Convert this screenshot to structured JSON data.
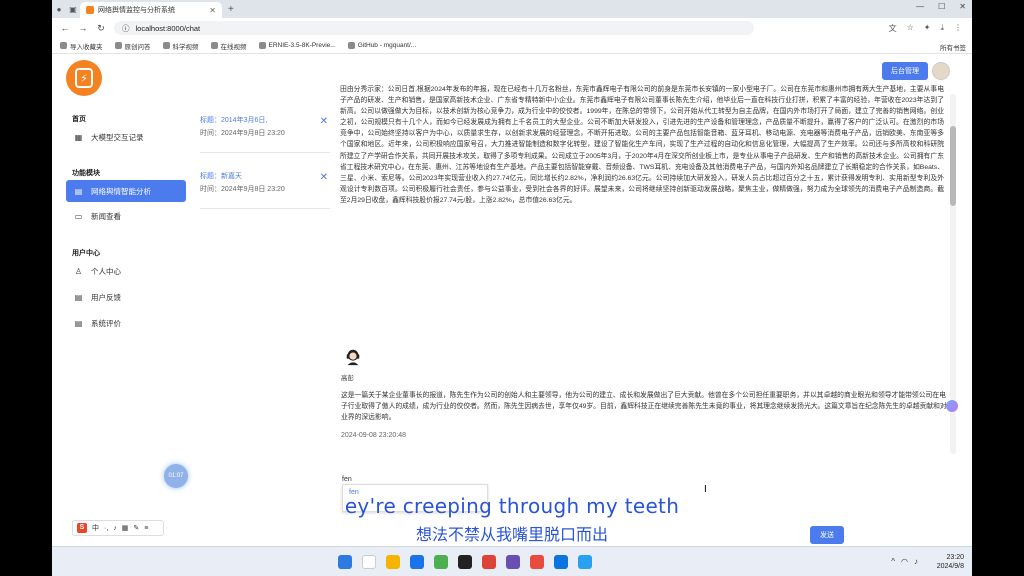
{
  "browser": {
    "tab_title": "网络舆情监控与分析系统",
    "url": "localhost:8000/chat",
    "bookmarks": [
      "导入收藏夹",
      "原创问答",
      "科学视频",
      "在线视频",
      "ERNIE-3.5-8K-Previe...",
      "GitHub - mgquant/..."
    ],
    "all_bookmarks": "所有书签"
  },
  "sidebar": {
    "home_title": "首页",
    "home_items": [
      {
        "label": "大模型交互记录",
        "icon": "grid-icon"
      }
    ],
    "func_title": "功能模块",
    "func_items": [
      {
        "label": "网络舆情智能分析",
        "icon": "doc-icon",
        "active": true
      },
      {
        "label": "新闻查看",
        "icon": "news-icon",
        "active": false
      }
    ],
    "user_title": "用户中心",
    "user_items": [
      {
        "label": "个人中心",
        "icon": "user-icon"
      },
      {
        "label": "用户反馈",
        "icon": "feedback-icon"
      },
      {
        "label": "系统评价",
        "icon": "rating-icon"
      }
    ],
    "assistant_ball": "01:07"
  },
  "history": [
    {
      "title": "标题：2014年3月6日,",
      "date": "时间：2024年9月8日 23:20"
    },
    {
      "title": "标题：新嘉天",
      "date": "时间：2024年9月8日 23:20"
    }
  ],
  "header": {
    "admin_button": "后台管理"
  },
  "main": {
    "paragraph": "田由分秀示家：公司日首,根据2024年发布的年报，现在已经有十几万名粉丝，东莞市鑫辉电子有限公司的前身是东莞市长安镇的一家小型电子厂。公司在东莞市和惠州市拥有两大生产基地，主要从事电子产品的研发、生产和销售，是国家高新技术企业、广东省专精特新中小企业。东莞市鑫辉电子有限公司董事长陈先生介绍，他毕业后一直在科技行业打拼，积累了丰富的经验，年营收在2023年达到了新高。公司以做强做大为目标，以技术创新为核心竞争力，成为行业中的佼佼者。1999年，在陈总的带领下，公司开始从代工转型为自主品牌，在国内外市场打开了局面，建立了完善的销售网络。创业之初，公司规模只有十几个人，而如今已经发展成为拥有上千名员工的大型企业。公司不断加大研发投入，引进先进的生产设备和管理理念，产品质量不断提升，赢得了客户的广泛认可。在激烈的市场竞争中，公司始终坚持以客户为中心，以质量求生存，以创新求发展的经营理念，不断开拓进取。公司的主要产品包括智能音箱、蓝牙耳机、移动电源、充电器等消费电子产品，远销欧美、东南亚等多个国家和地区。近年来，公司积极响应国家号召，大力推进智能制造和数字化转型，建设了智能化生产车间，实现了生产过程的自动化和信息化管理，大幅提高了生产效率。公司还与多所高校和科研院所建立了产学研合作关系，共同开展技术攻关，取得了多项专利成果。公司成立于2005年3月，于2020年4月在深交所创业板上市，是专业从事电子产品研发、生产和销售的高新技术企业。公司拥有广东省工程技术研究中心，在东莞、惠州、江苏等地设有生产基地。产品主要包括智能穿戴、音频设备、TWS耳机、充电设备及其他消费电子产品，与国内外知名品牌建立了长期稳定的合作关系，如Beats、三星、小米、索尼等。公司2023年实现营业收入约27.74亿元，同比增长约2.82%，净利润约26.63亿元。公司持续加大研发投入，研发人员占比超过百分之十五，累计获得发明专利、实用新型专利及外观设计专利数百项。公司积极履行社会责任，参与公益事业，受到社会各界的好评。展望未来，公司将继续坚持创新驱动发展战略，聚焦主业，做精做强，努力成为全球领先的消费电子产品制造商。截至2月29日收盘，鑫辉科技股价报27.74元/股，上涨2.82%，总市值26.63亿元。",
    "author": "高彭",
    "answer": "这是一篇关于某企业董事长的报道，陈先生作为公司的创始人和主要领导，他为公司的建立、成长和发展做出了巨大贡献。他曾在多个公司担任重要职务，并以其卓越的商业眼光和领导才能带领公司在电子行业取得了傲人的成绩，成为行业的佼佼者。然而，陈先生因病去世，享年仅49岁。目前，鑫辉科技正在继续完善陈先生未竟的事业，将其理念继续发扬光大。这篇文章旨在纪念陈先生的卓越贡献和对业界的深远影响。",
    "timestamp": "2024-09-08 23:20:48"
  },
  "input": {
    "current_text": "fen",
    "ime_candidate": "fen",
    "send_button": "发送"
  },
  "subtitles": {
    "english": "ey're creeping through my teeth",
    "chinese": "想法不禁从我嘴里脱口而出"
  },
  "taskbar": {
    "time": "23:20",
    "date": "2024/9/8"
  }
}
